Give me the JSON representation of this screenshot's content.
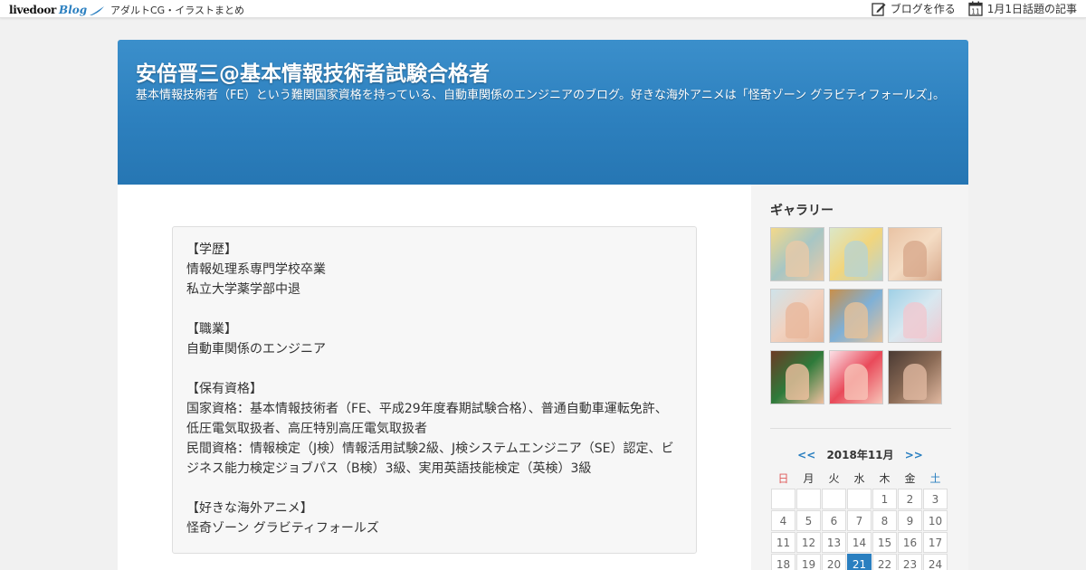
{
  "topbar": {
    "logo_text": "livedoor",
    "logo_blog": "Blog",
    "sub_label": "アダルトCG・イラストまとめ",
    "create_blog": "ブログを作る",
    "topic_label": "1月1日話題の記事",
    "calendar_icon_day": "11"
  },
  "header": {
    "title": "安倍晋三@基本情報技術者試験合格者",
    "description": "基本情報技術者（FE）という難関国家資格を持っている、自動車関係のエンジニアのブログ。好きな海外アニメは「怪奇ゾーン グラビティフォールズ」。"
  },
  "profile": {
    "lines": [
      "【学歴】",
      "情報処理系専門学校卒業",
      "私立大学薬学部中退",
      "",
      "【職業】",
      "自動車関係のエンジニア",
      "",
      "【保有資格】",
      "国家資格：基本情報技術者（FE、平成29年度春期試験合格）、普通自動車運転免許、",
      "低圧電気取扱者、高圧特別高圧電気取扱者",
      "民間資格：情報検定（J検）情報活用試験2級、J検システムエンジニア（SE）認定、ビ",
      "ジネス能力検定ジョブパス（B検）3級、実用英語技能検定（英検）3級",
      "",
      "【好きな海外アニメ】",
      "怪奇ゾーン グラビティフォールズ"
    ]
  },
  "sidebar": {
    "gallery_title": "ギャラリー",
    "gallery_count": 9,
    "calendar": {
      "prev": "<<",
      "month": "2018年11月",
      "next": ">>",
      "weekdays": [
        "日",
        "月",
        "火",
        "水",
        "木",
        "金",
        "土"
      ],
      "rows": [
        [
          "",
          "",
          "",
          "",
          "1",
          "2",
          "3"
        ],
        [
          "4",
          "5",
          "6",
          "7",
          "8",
          "9",
          "10"
        ],
        [
          "11",
          "12",
          "13",
          "14",
          "15",
          "16",
          "17"
        ],
        [
          "18",
          "19",
          "20",
          "21",
          "22",
          "23",
          "24"
        ]
      ],
      "today": "21"
    }
  },
  "colors": {
    "header_blue": "#2d80be",
    "accent": "#2a7fc0"
  }
}
